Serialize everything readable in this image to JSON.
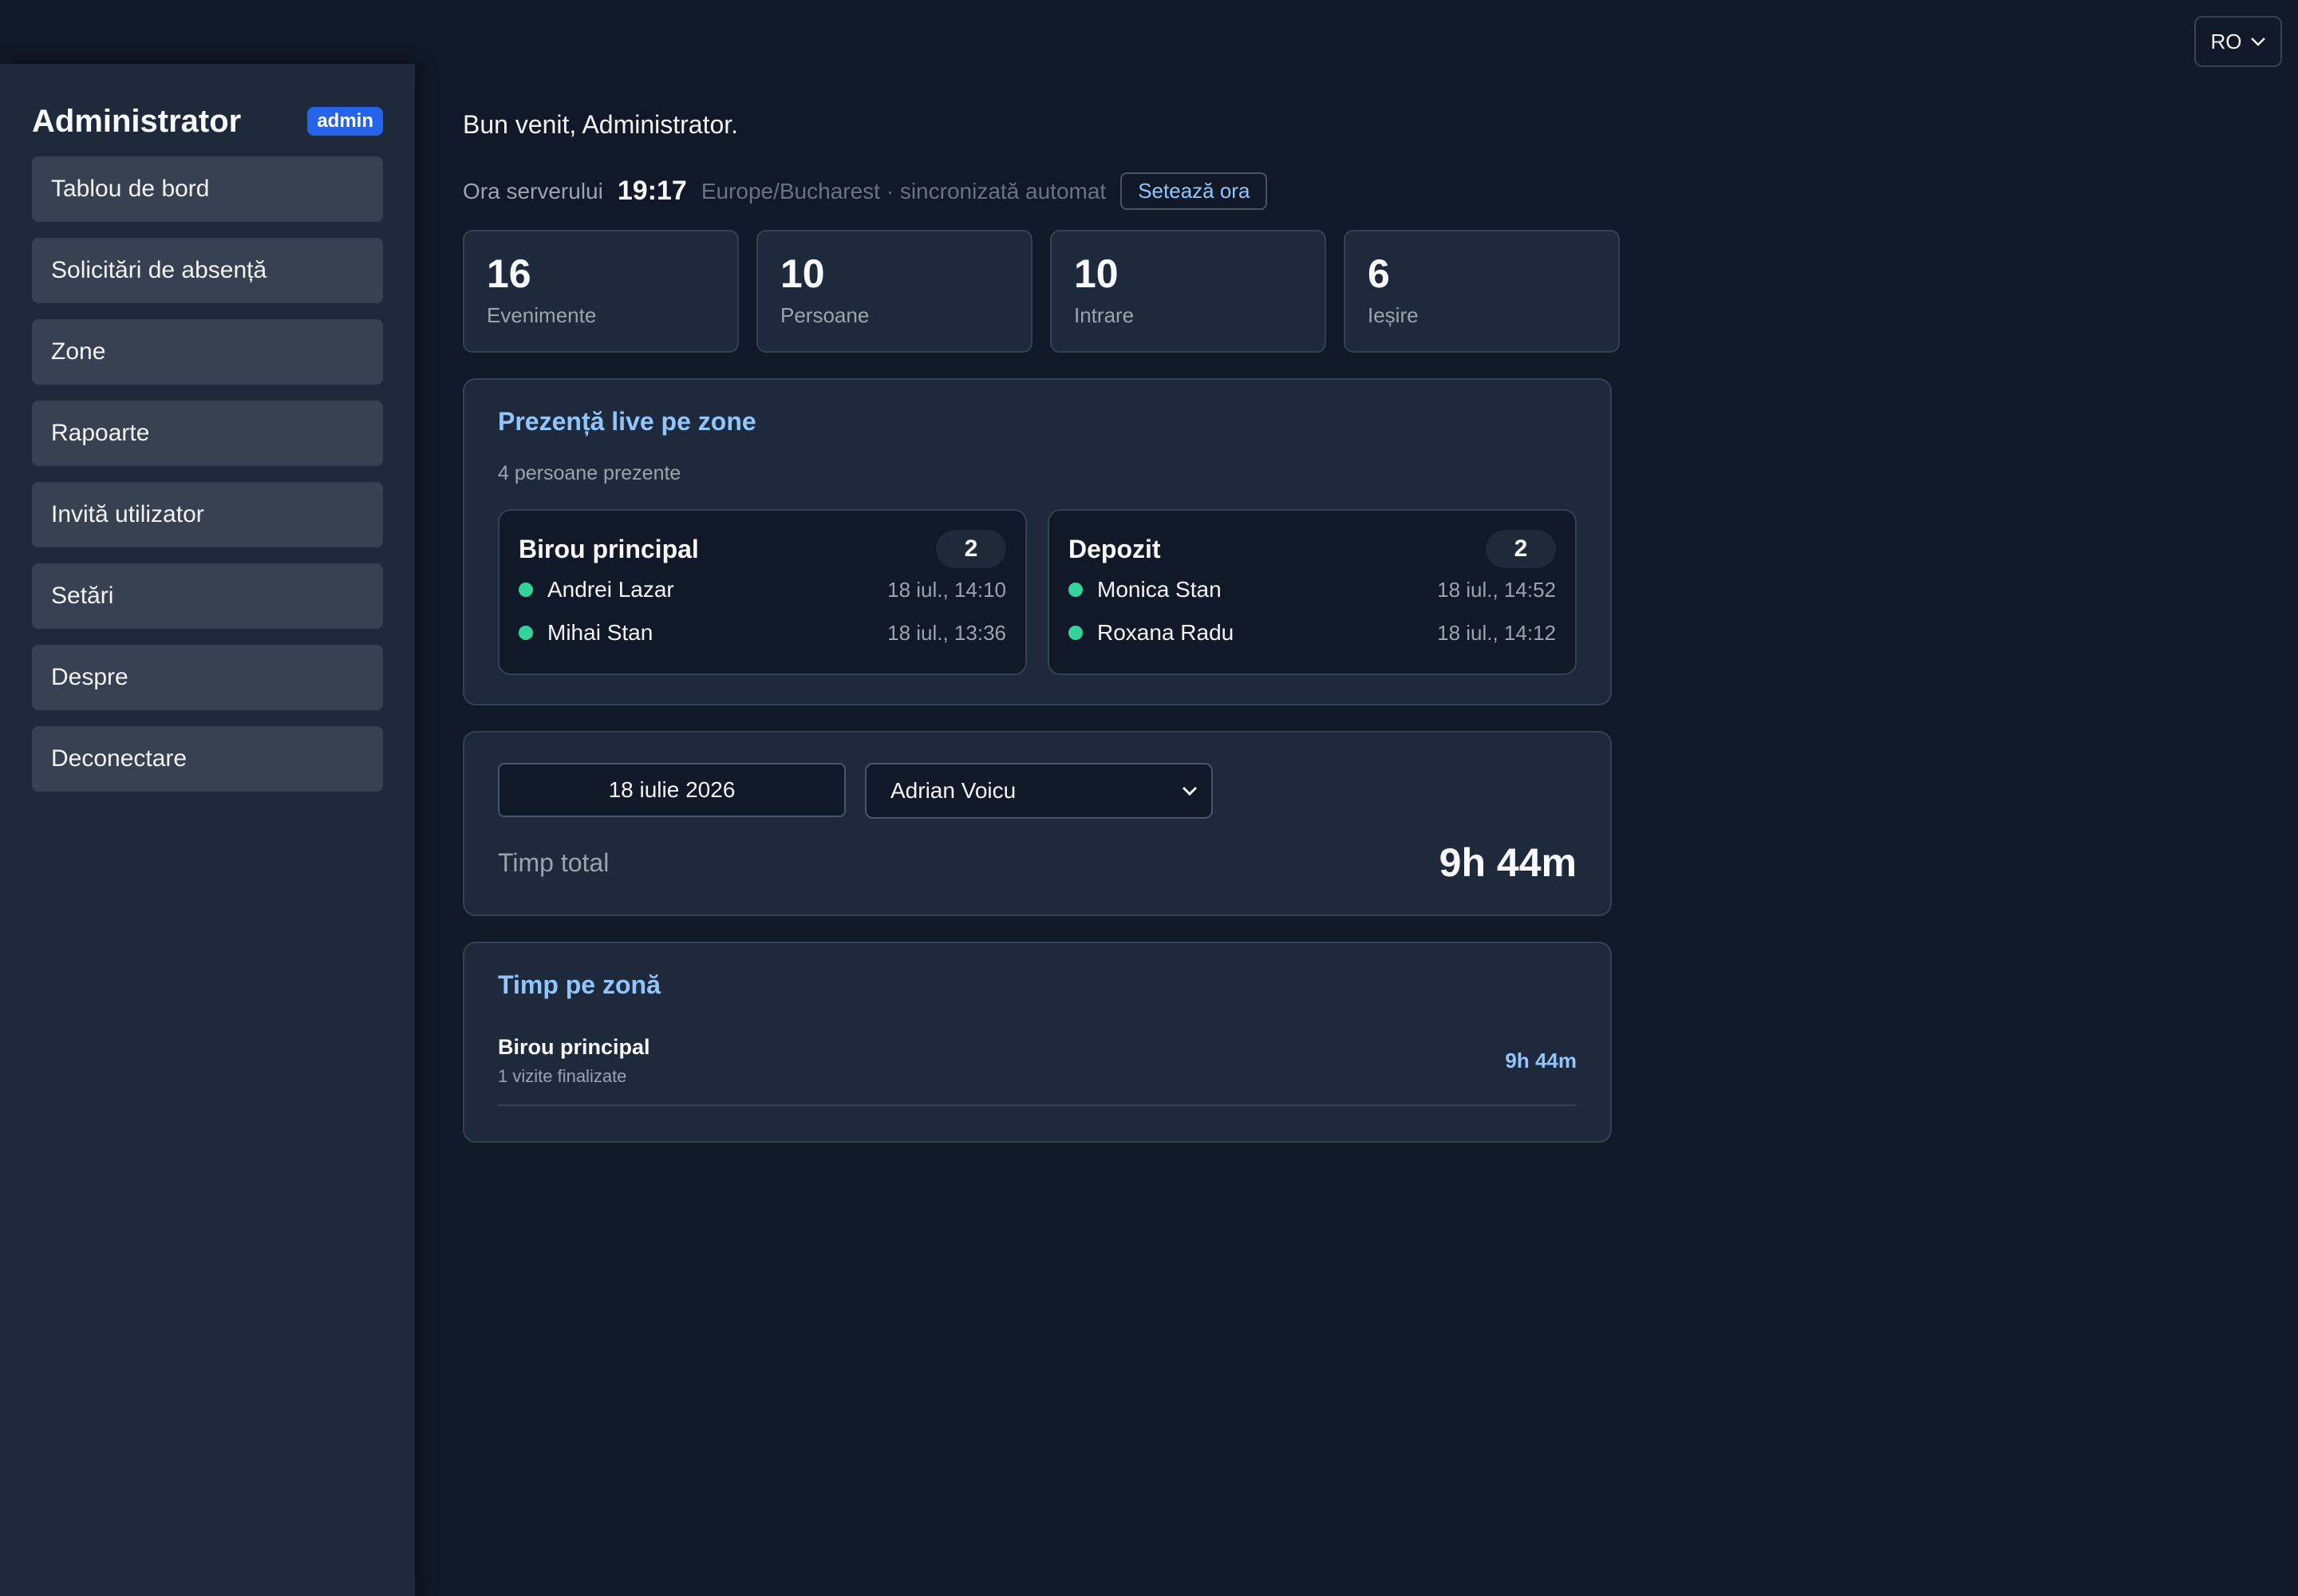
{
  "language": {
    "label": "RO"
  },
  "sidebar": {
    "title": "Administrator",
    "role_badge": "admin",
    "items": [
      {
        "label": "Tablou de bord"
      },
      {
        "label": "Solicitări de absență"
      },
      {
        "label": "Zone"
      },
      {
        "label": "Rapoarte"
      },
      {
        "label": "Invită utilizator"
      },
      {
        "label": "Setări"
      },
      {
        "label": "Despre"
      },
      {
        "label": "Deconectare"
      }
    ]
  },
  "main": {
    "welcome": "Bun venit, Administrator.",
    "server": {
      "label": "Ora serverului",
      "time": "19:17",
      "timezone": "Europe/Bucharest · sincronizată automat",
      "set_button": "Setează ora"
    },
    "stats": [
      {
        "value": "16",
        "label": "Evenimente"
      },
      {
        "value": "10",
        "label": "Persoane"
      },
      {
        "value": "10",
        "label": "Intrare"
      },
      {
        "value": "6",
        "label": "Ieșire"
      }
    ],
    "live": {
      "title": "Prezență live pe zone",
      "subtitle": "4 persoane prezente",
      "zones": [
        {
          "name": "Birou principal",
          "count": "2",
          "people": [
            {
              "name": "Andrei Lazar",
              "time": "18 iul., 14:10"
            },
            {
              "name": "Mihai Stan",
              "time": "18 iul., 13:36"
            }
          ]
        },
        {
          "name": "Depozit",
          "count": "2",
          "people": [
            {
              "name": "Monica Stan",
              "time": "18 iul., 14:52"
            },
            {
              "name": "Roxana Radu",
              "time": "18 iul., 14:12"
            }
          ]
        }
      ]
    },
    "timesheet": {
      "date_value": "18 iulie 2026",
      "person_selected": "Adrian Voicu",
      "total_label": "Timp total",
      "total_value": "9h 44m"
    },
    "zone_time": {
      "title": "Timp pe zonă",
      "rows": [
        {
          "name": "Birou principal",
          "sub": "1 vizite finalizate",
          "value": "9h 44m"
        }
      ]
    }
  },
  "colors": {
    "background": "#111827",
    "panel": "#1e293b",
    "accent": "#93c5fd",
    "badge": "#2563eb",
    "presence_dot": "#34d399"
  }
}
